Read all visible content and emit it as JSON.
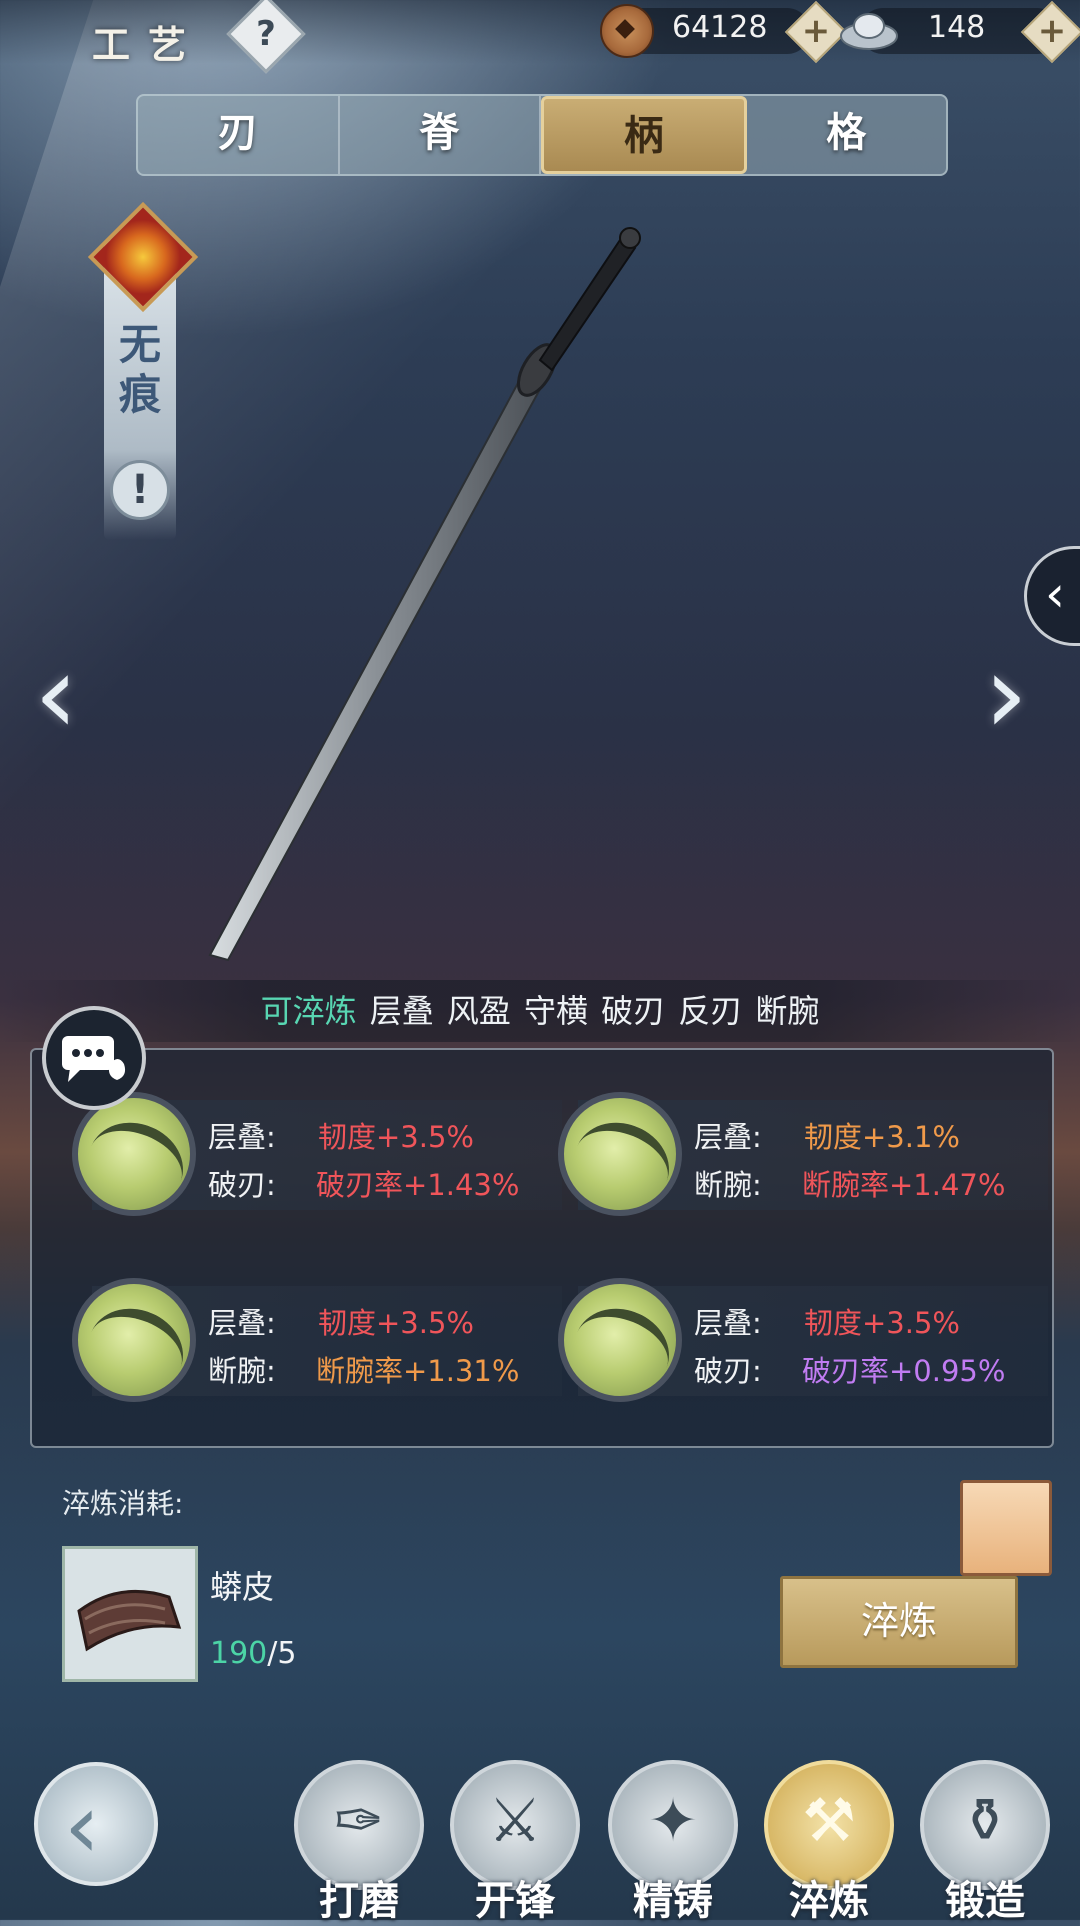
{
  "header": {
    "title": "工艺",
    "help_symbol": "?",
    "currency_copper": "64128",
    "currency_silver": "148",
    "plus_symbol": "+"
  },
  "tabs": [
    {
      "label": "刃",
      "active": false
    },
    {
      "label": "脊",
      "active": false
    },
    {
      "label": "柄",
      "active": true
    },
    {
      "label": "格",
      "active": false
    }
  ],
  "weapon": {
    "name": "无痕",
    "info_symbol": "!"
  },
  "keywords": [
    "可淬炼",
    "层叠",
    "风盈",
    "守横",
    "破刃",
    "反刃",
    "断腕"
  ],
  "stats": [
    {
      "line1_label": "层叠:",
      "line1_value": "韧度+3.5%",
      "line1_color": "red",
      "line2_label": "破刃:",
      "line2_value": "破刃率+1.43%",
      "line2_color": "red"
    },
    {
      "line1_label": "层叠:",
      "line1_value": "韧度+3.1%",
      "line1_color": "orange",
      "line2_label": "断腕:",
      "line2_value": "断腕率+1.47%",
      "line2_color": "red"
    },
    {
      "line1_label": "层叠:",
      "line1_value": "韧度+3.5%",
      "line1_color": "red",
      "line2_label": "断腕:",
      "line2_value": "断腕率+1.31%",
      "line2_color": "orange"
    },
    {
      "line1_label": "层叠:",
      "line1_value": "韧度+3.5%",
      "line1_color": "red",
      "line2_label": "破刃:",
      "line2_value": "破刃率+0.95%",
      "line2_color": "purple"
    }
  ],
  "cost": {
    "label": "淬炼消耗:",
    "item_name": "蟒皮",
    "have": "190",
    "need": "/5"
  },
  "action_button": "淬炼",
  "bottom_nav": [
    {
      "label": "打磨",
      "glyph": "✑",
      "active": false
    },
    {
      "label": "开锋",
      "glyph": "⚔",
      "active": false
    },
    {
      "label": "精铸",
      "glyph": "✦",
      "active": false
    },
    {
      "label": "淬炼",
      "glyph": "⚒",
      "active": true
    },
    {
      "label": "锻造",
      "glyph": "⚱",
      "active": false
    }
  ],
  "colors": {
    "accent_gold": "#c9ad74",
    "teal": "#58d6b2",
    "red": "#f0555a",
    "orange": "#f09a4a",
    "purple": "#c17cf2"
  }
}
